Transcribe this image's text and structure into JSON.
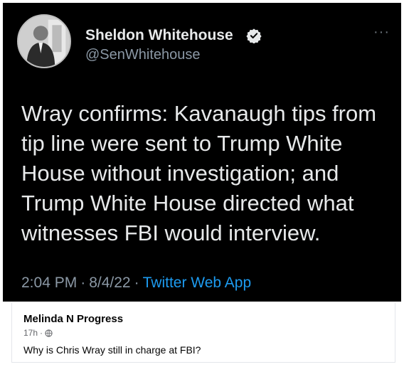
{
  "tweet": {
    "author_name": "Sheldon Whitehouse",
    "author_handle": "@SenWhitehouse",
    "text": "Wray confirms: Kavanaugh tips from tip line were sent to Trump White House without investigation; and Trump White House directed what witnesses FBI would interview.",
    "time": "2:04 PM",
    "date": "8/4/22",
    "separator": "·",
    "source_app": "Twitter Web App",
    "more_icon": "···",
    "icons": [
      "verified-badge-icon",
      "more-icon",
      "avatar"
    ],
    "colors": {
      "background": "#000000",
      "text": "#e7e9ea",
      "muted": "#8b98a5",
      "link": "#1d9bf0"
    }
  },
  "comment": {
    "author_name": "Melinda N Progress",
    "time": "17h",
    "separator": "·",
    "text": "Why is Chris Wray still in charge at FBI?",
    "icons": [
      "globe-icon"
    ]
  }
}
